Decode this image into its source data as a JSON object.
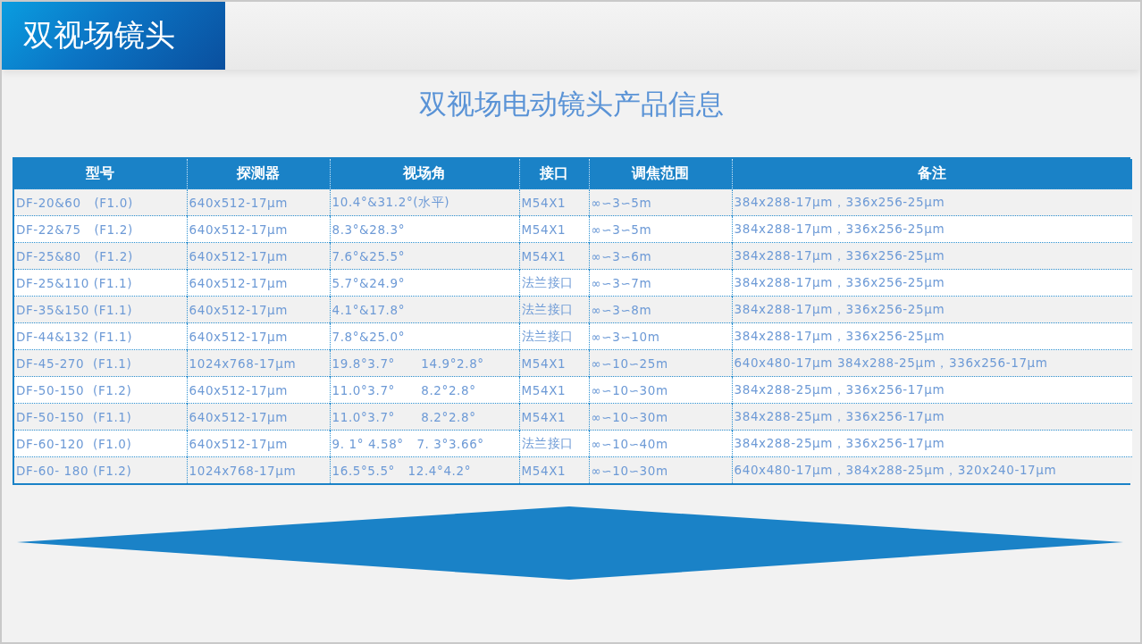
{
  "header": {
    "title": "双视场镜头"
  },
  "subtitle": "双视场电动镜头产品信息",
  "table": {
    "columns": [
      "型号",
      "探测器",
      "视场角",
      "接口",
      "调焦范围",
      "备注"
    ],
    "rows": [
      [
        "DF-20&60   (F1.0)",
        "640x512-17μm",
        "10.4°&31.2°(水平)",
        "M54X1",
        "∞∽3∽5m",
        "384x288-17μm，336x256-25μm"
      ],
      [
        "DF-22&75   (F1.2)",
        "640x512-17μm",
        "8.3°&28.3°",
        "M54X1",
        "∞∽3∽5m",
        "384x288-17μm，336x256-25μm"
      ],
      [
        "DF-25&80   (F1.2)",
        "640x512-17μm",
        "7.6°&25.5°",
        "M54X1",
        "∞∽3∽6m",
        "384x288-17μm，336x256-25μm"
      ],
      [
        "DF-25&110 (F1.1)",
        "640x512-17μm",
        "5.7°&24.9°",
        "法兰接口",
        "∞∽3∽7m",
        "384x288-17μm，336x256-25μm"
      ],
      [
        "DF-35&150 (F1.1)",
        "640x512-17μm",
        "4.1°&17.8°",
        "法兰接口",
        "∞∽3∽8m",
        "384x288-17μm，336x256-25μm"
      ],
      [
        "DF-44&132 (F1.1)",
        "640x512-17μm",
        "7.8°&25.0°",
        "法兰接口",
        "∞∽3∽10m",
        "384x288-17μm，336x256-25μm"
      ],
      [
        "DF-45-270  (F1.1)",
        "1024x768-17μm",
        "19.8°3.7°      14.9°2.8°",
        "M54X1",
        "∞∽10∽25m",
        "640x480-17μm 384x288-25μm，336x256-17μm"
      ],
      [
        "DF-50-150  (F1.2)",
        "640x512-17μm",
        "11.0°3.7°      8.2°2.8°",
        "M54X1",
        "∞∽10∽30m",
        "384x288-25μm，336x256-17μm"
      ],
      [
        "DF-50-150  (F1.1)",
        "640x512-17μm",
        "11.0°3.7°      8.2°2.8°",
        "M54X1",
        "∞∽10∽30m",
        "384x288-25μm，336x256-17μm"
      ],
      [
        "DF-60-120  (F1.0)",
        "640x512-17μm",
        "9. 1° 4.58°   7. 3°3.66°",
        "法兰接口",
        "∞∽10∽40m",
        "384x288-25μm，336x256-17μm"
      ],
      [
        "DF-60- 180 (F1.2)",
        "1024x768-17μm",
        "16.5°5.5°   12.4°4.2°",
        "M54X1",
        "∞∽10∽30m",
        "640x480-17μm，384x288-25μm，320x240-17μm"
      ]
    ]
  }
}
